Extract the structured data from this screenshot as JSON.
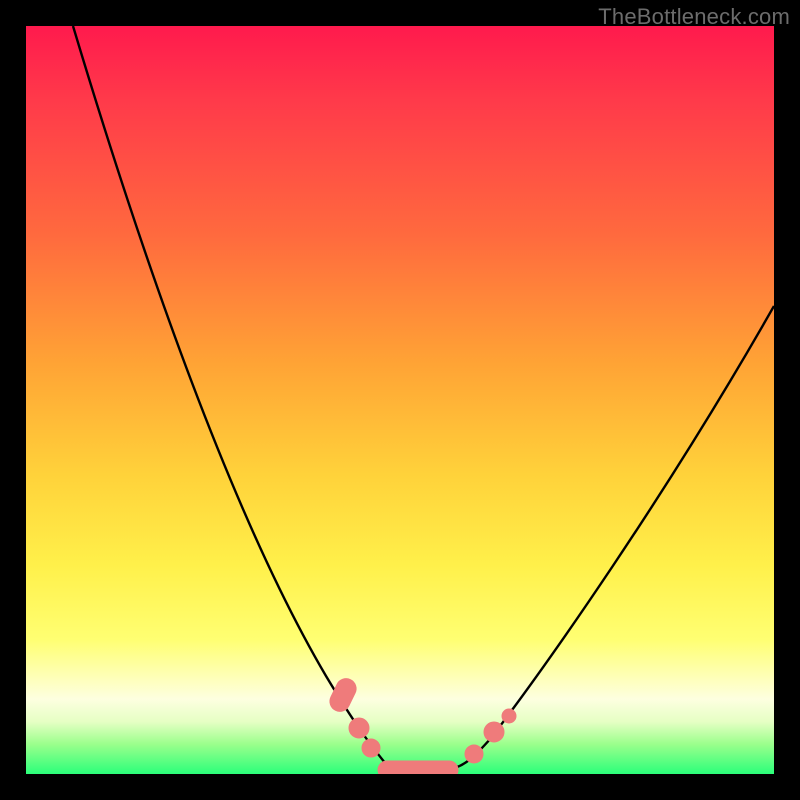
{
  "watermark": "TheBottleneck.com",
  "chart_data": {
    "type": "line",
    "title": "",
    "xlabel": "",
    "ylabel": "",
    "xlim": [
      0,
      100
    ],
    "ylim": [
      0,
      100
    ],
    "background_gradient": {
      "direction": "vertical",
      "stops": [
        {
          "pos": 0,
          "color": "#ff1a4d"
        },
        {
          "pos": 28,
          "color": "#ff6a3e"
        },
        {
          "pos": 60,
          "color": "#ffd23a"
        },
        {
          "pos": 82,
          "color": "#ffff72"
        },
        {
          "pos": 93,
          "color": "#e6ffc4"
        },
        {
          "pos": 100,
          "color": "#2bff7a"
        }
      ]
    },
    "series": [
      {
        "name": "bottleneck-curve",
        "color": "#000000",
        "x": [
          5,
          10,
          15,
          20,
          25,
          30,
          35,
          38,
          42,
          45,
          48,
          52,
          55,
          58,
          62,
          68,
          75,
          82,
          90,
          98
        ],
        "y": [
          100,
          89,
          78,
          67,
          56,
          45,
          33,
          22,
          10,
          3,
          0,
          0,
          0,
          3,
          9,
          18,
          29,
          40,
          52,
          63
        ]
      }
    ],
    "markers": [
      {
        "name": "marker-cluster",
        "color": "#ef7b7b",
        "shape": "rounded",
        "points": [
          {
            "x": 42,
            "y": 10
          },
          {
            "x": 43,
            "y": 6
          },
          {
            "x": 44,
            "y": 3
          },
          {
            "x": 48,
            "y": 0
          },
          {
            "x": 50,
            "y": 0
          },
          {
            "x": 52,
            "y": 0
          },
          {
            "x": 54,
            "y": 0
          },
          {
            "x": 56,
            "y": 0
          },
          {
            "x": 59,
            "y": 4
          },
          {
            "x": 62,
            "y": 9
          },
          {
            "x": 64,
            "y": 13
          }
        ]
      }
    ]
  }
}
